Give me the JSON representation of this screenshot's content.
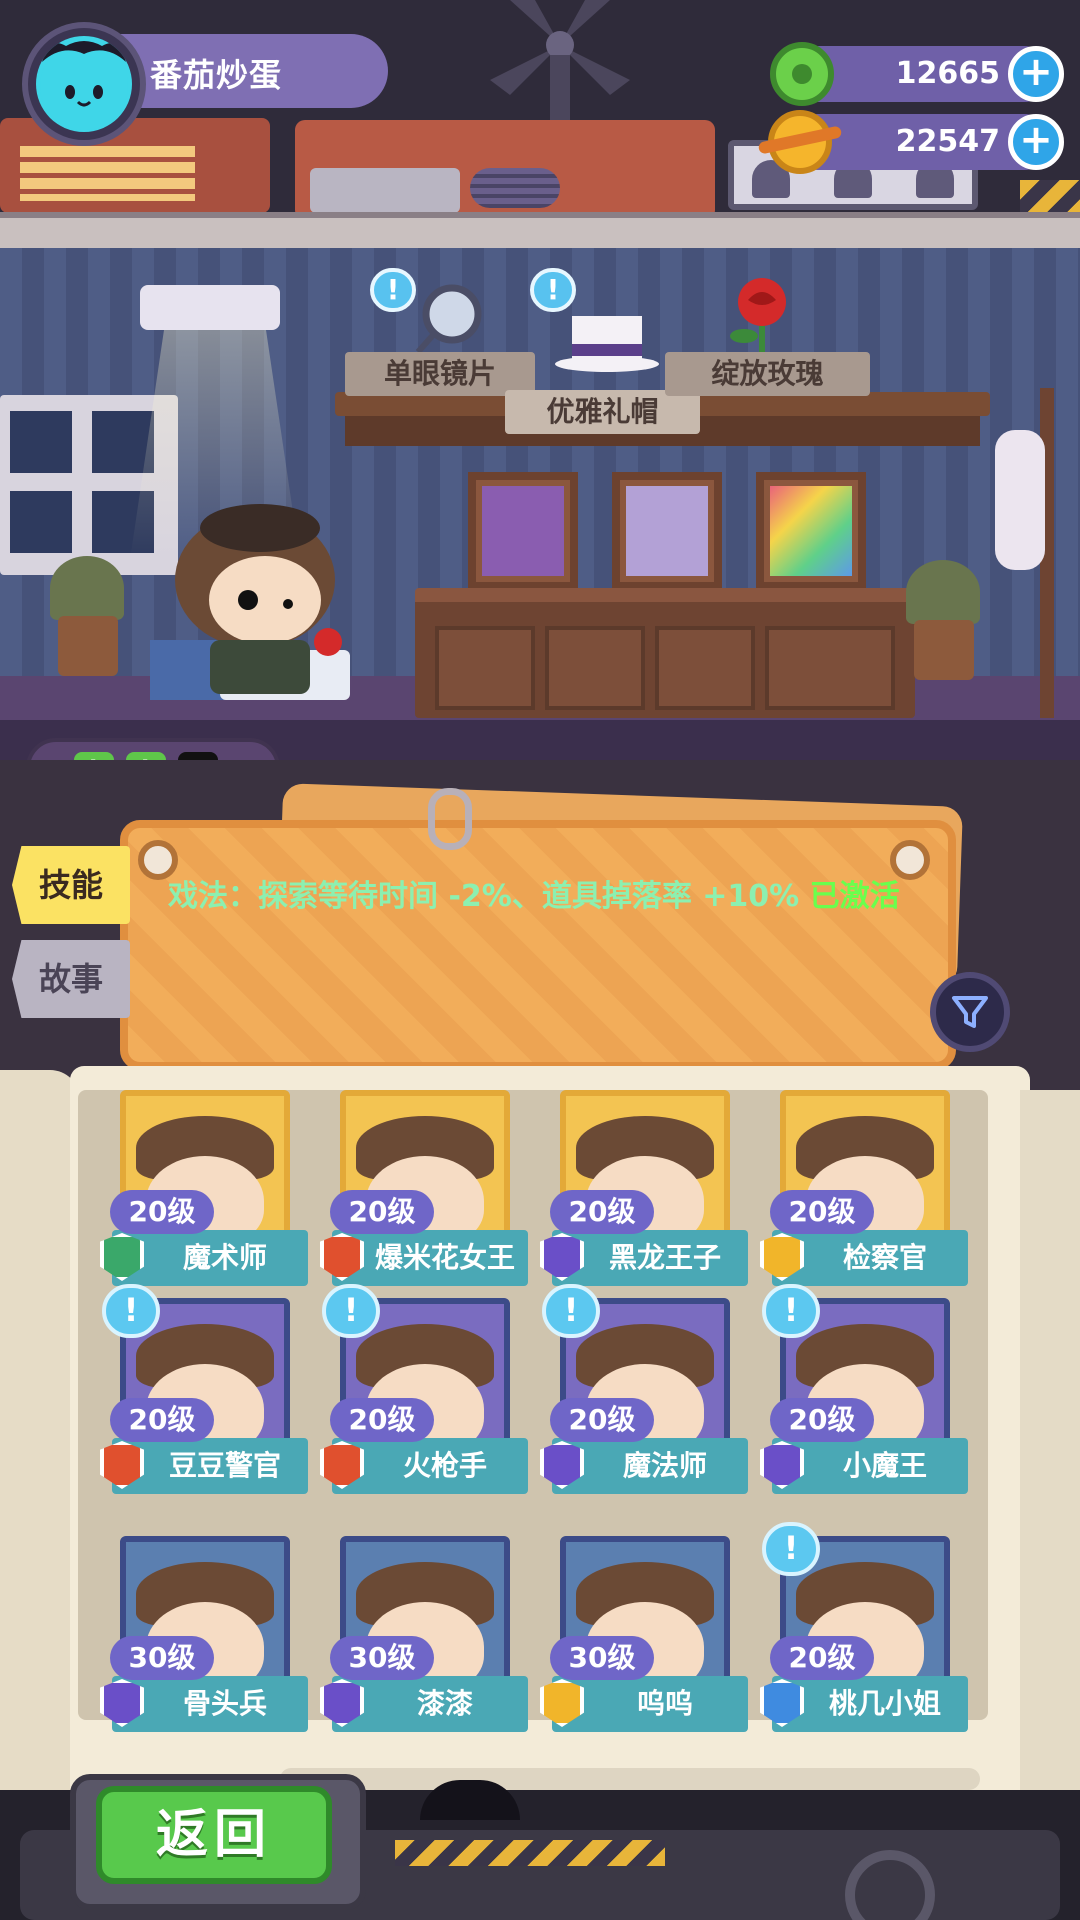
{
  "player": {
    "name": "番茄炒蛋",
    "avatar_icon": "cat-avatar-icon"
  },
  "currencies": [
    {
      "icon": "donut-coin-icon",
      "value": "12665",
      "color": "#6bd04a"
    },
    {
      "icon": "planet-coin-icon",
      "value": "22547",
      "color": "#f5b52c"
    }
  ],
  "shelf": {
    "items": [
      {
        "label": "单眼镜片",
        "icon": "monocle-icon"
      },
      {
        "label": "优雅礼帽",
        "icon": "top-hat-icon"
      },
      {
        "label": "绽放玫瑰",
        "icon": "rose-icon"
      }
    ]
  },
  "energy": {
    "filled": 2,
    "total": 3
  },
  "tabs": {
    "skill": "技能",
    "story": "故事"
  },
  "skill_info": {
    "text": "戏法：探索等待时间 -2%、道具掉落率 +10% ",
    "status": "已激活"
  },
  "characters": [
    {
      "level": "20级",
      "name": "魔术师",
      "badge_color": "#3aa86a",
      "frame": "gold",
      "alert": false
    },
    {
      "level": "20级",
      "name": "爆米花女王",
      "badge_color": "#e0502e",
      "frame": "gold",
      "alert": false
    },
    {
      "level": "20级",
      "name": "黑龙王子",
      "badge_color": "#6a4fc8",
      "frame": "gold",
      "alert": false
    },
    {
      "level": "20级",
      "name": "检察官",
      "badge_color": "#f1b52a",
      "frame": "gold",
      "alert": false
    },
    {
      "level": "20级",
      "name": "豆豆警官",
      "badge_color": "#e0502e",
      "frame": "purple",
      "alert": true
    },
    {
      "level": "20级",
      "name": "火枪手",
      "badge_color": "#e0502e",
      "frame": "purple",
      "alert": true
    },
    {
      "level": "20级",
      "name": "魔法师",
      "badge_color": "#6a4fc8",
      "frame": "purple",
      "alert": true
    },
    {
      "level": "20级",
      "name": "小魔王",
      "badge_color": "#6a4fc8",
      "frame": "purple",
      "alert": true
    },
    {
      "level": "30级",
      "name": "骨头兵",
      "badge_color": "#6a4fc8",
      "frame": "blue",
      "alert": false
    },
    {
      "level": "30级",
      "name": "漆漆",
      "badge_color": "#6a4fc8",
      "frame": "blue",
      "alert": false
    },
    {
      "level": "30级",
      "name": "呜呜",
      "badge_color": "#f1b52a",
      "frame": "blue",
      "alert": false
    },
    {
      "level": "20级",
      "name": "桃几小姐",
      "badge_color": "#3f8be0",
      "frame": "blue",
      "alert": true
    }
  ],
  "back_button": "返回"
}
